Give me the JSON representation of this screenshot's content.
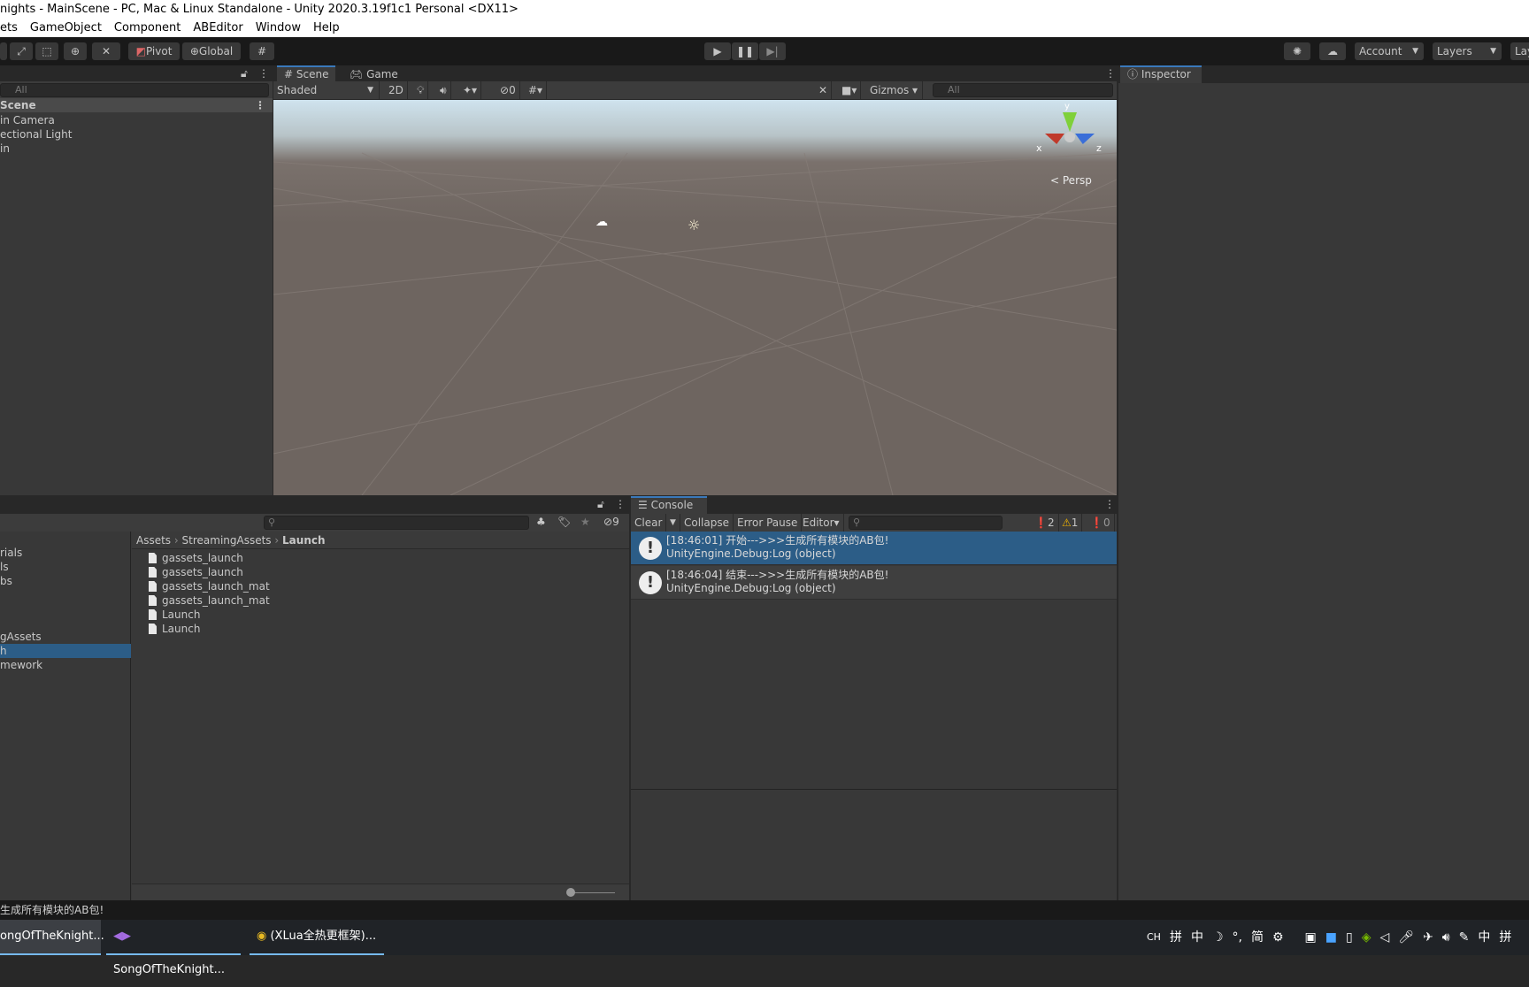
{
  "window": {
    "title": "nights - MainScene - PC, Mac & Linux Standalone - Unity 2020.3.19f1c1 Personal <DX11>"
  },
  "menu": [
    "ets",
    "GameObject",
    "Component",
    "ABEditor",
    "Window",
    "Help"
  ],
  "toolbar": {
    "pivot": "Pivot",
    "global": "Global",
    "account": "Account",
    "layers": "Layers",
    "layout": "Lay"
  },
  "hierarchy": {
    "search_placeholder": "All",
    "scene": "Scene",
    "items": [
      "in Camera",
      "ectional Light",
      "in"
    ]
  },
  "scene": {
    "tab_scene": "Scene",
    "tab_game": "Game",
    "shading": "Shaded",
    "mode_2d": "2D",
    "hidden_count": "0",
    "gizmos": "Gizmos",
    "search_placeholder": "All",
    "projection": "Persp",
    "axes": {
      "x": "x",
      "y": "y",
      "z": "z"
    }
  },
  "inspector": {
    "tab": "Inspector"
  },
  "project": {
    "tree": [
      "rials",
      "ls",
      "bs",
      "gAssets",
      "h",
      "mework"
    ],
    "selected_index": 4,
    "hidden_count": "9",
    "breadcrumb": [
      "Assets",
      "StreamingAssets",
      "Launch"
    ],
    "files": [
      "gassets_launch",
      "gassets_launch",
      "gassets_launch_mat",
      "gassets_launch_mat",
      "Launch",
      "Launch"
    ],
    "zoom_slider": 0
  },
  "console": {
    "tab": "Console",
    "clear": "Clear",
    "collapse": "Collapse",
    "error_pause": "Error Pause",
    "editor": "Editor",
    "log_count": "2",
    "warn_count": "1",
    "error_count": "0",
    "entries": [
      {
        "line1": "[18:46:01] 开始--->>>生成所有模块的AB包!",
        "line2": "UnityEngine.Debug:Log (object)",
        "selected": true
      },
      {
        "line1": "[18:46:04] 结束--->>>生成所有模块的AB包!",
        "line2": "UnityEngine.Debug:Log (object)",
        "selected": false
      }
    ]
  },
  "status_bar": {
    "message": "生成所有模块的AB包!"
  },
  "taskbar": {
    "items": [
      "ongOfTheKnight...",
      "SongOfTheKnight...",
      "(XLua全热更框架)..."
    ],
    "tray": [
      "CH",
      "拼",
      "中",
      "☽",
      "°,",
      "简",
      "中",
      "拼"
    ]
  },
  "colors": {
    "accent": "#3a79bb",
    "selection": "#2c5d87",
    "sky": "#cfe3ee",
    "ground": "#6e6560"
  }
}
